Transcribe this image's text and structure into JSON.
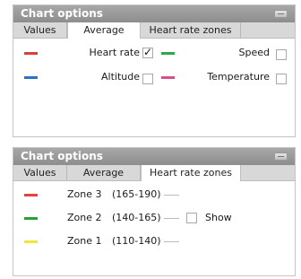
{
  "panel1": {
    "title": "Chart options",
    "tabs": [
      "Values",
      "Average",
      "Heart rate zones"
    ],
    "active_tab": "Average",
    "series": [
      {
        "label": "Heart rate",
        "color": "#d9403a",
        "checked": true
      },
      {
        "label": "Speed",
        "color": "#2aa84a",
        "checked": false
      },
      {
        "label": "Altitude",
        "color": "#2a74c8",
        "checked": false
      },
      {
        "label": "Temperature",
        "color": "#d6508a",
        "checked": false
      }
    ]
  },
  "panel2": {
    "title": "Chart options",
    "tabs": [
      "Values",
      "Average",
      "Heart rate zones"
    ],
    "active_tab": "Heart rate zones",
    "zones": [
      {
        "label": "Zone 3",
        "range": "(165-190)",
        "color": "#e8403a"
      },
      {
        "label": "Zone 2",
        "range": "(140-165)",
        "color": "#23a32f"
      },
      {
        "label": "Zone 1",
        "range": "(110-140)",
        "color": "#f0e63a"
      }
    ],
    "show_label": "Show",
    "show_checked": false
  }
}
